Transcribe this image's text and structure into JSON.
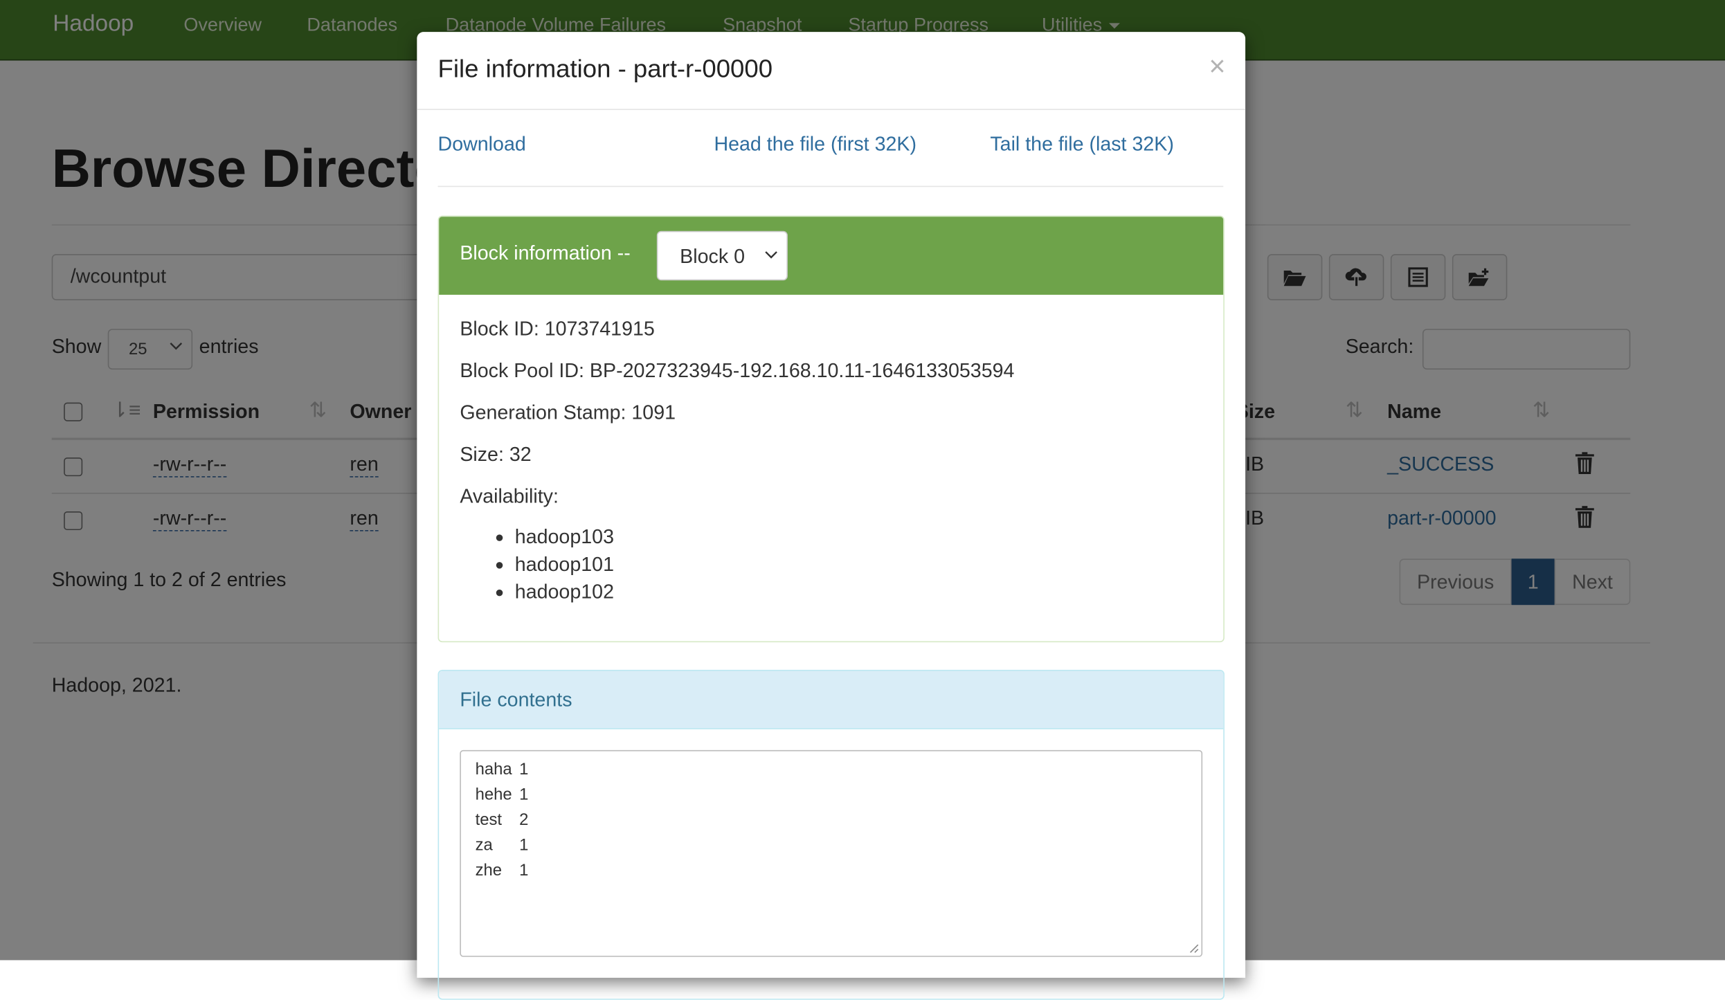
{
  "navbar": {
    "brand": "Hadoop",
    "items": [
      {
        "label": "Overview"
      },
      {
        "label": "Datanodes"
      },
      {
        "label": "Datanode Volume Failures"
      },
      {
        "label": "Snapshot"
      },
      {
        "label": "Startup Progress"
      },
      {
        "label": "Utilities"
      }
    ]
  },
  "page": {
    "title": "Browse Directo",
    "path_value": "/wcountput",
    "toolbar_icons": [
      "folder-open-icon",
      "cloud-upload-icon",
      "list-icon",
      "folder-new-icon"
    ],
    "show_label": "Show",
    "entries_value": "25",
    "entries_label": "entries",
    "search_label": "Search:",
    "search_value": "",
    "columns": {
      "permission": "Permission",
      "owner": "Owner",
      "size_partial": ": Size",
      "name": "Name"
    },
    "rows": [
      {
        "permission": "-rw-r--r--",
        "owner": "ren",
        "size_partial": "IB",
        "name": "_SUCCESS"
      },
      {
        "permission": "-rw-r--r--",
        "owner": "ren",
        "size_partial": "IB",
        "name": "part-r-00000"
      }
    ],
    "showing": "Showing 1 to 2 of 2 entries",
    "pagination": {
      "previous": "Previous",
      "current": "1",
      "next": "Next"
    },
    "footer": "Hadoop, 2021."
  },
  "modal": {
    "title": "File information - part-r-00000",
    "close": "×",
    "links": {
      "download": "Download",
      "head": "Head the file (first 32K)",
      "tail": "Tail the file (last 32K)"
    },
    "block_info_label": "Block information --",
    "block_select_value": "Block 0",
    "block_id": "Block ID: 1073741915",
    "block_pool_id": "Block Pool ID: BP-2027323945-192.168.10.11-1646133053594",
    "generation_stamp": "Generation Stamp: 1091",
    "size": "Size: 32",
    "availability_label": "Availability:",
    "availability": [
      "hadoop103",
      "hadoop101",
      "hadoop102"
    ],
    "file_contents_label": "File contents",
    "file_lines": [
      {
        "word": "haha",
        "count": "1"
      },
      {
        "word": "hehe",
        "count": "1"
      },
      {
        "word": "test",
        "count": "2"
      },
      {
        "word": "za",
        "count": "1"
      },
      {
        "word": "zhe",
        "count": "1"
      }
    ]
  },
  "colors": {
    "navbar": "#4f8a2f",
    "block_header": "#6ea34a",
    "link": "#2f6d9e",
    "pagination_active": "#2d5f8e",
    "file_contents_header": "#d9edf7"
  }
}
